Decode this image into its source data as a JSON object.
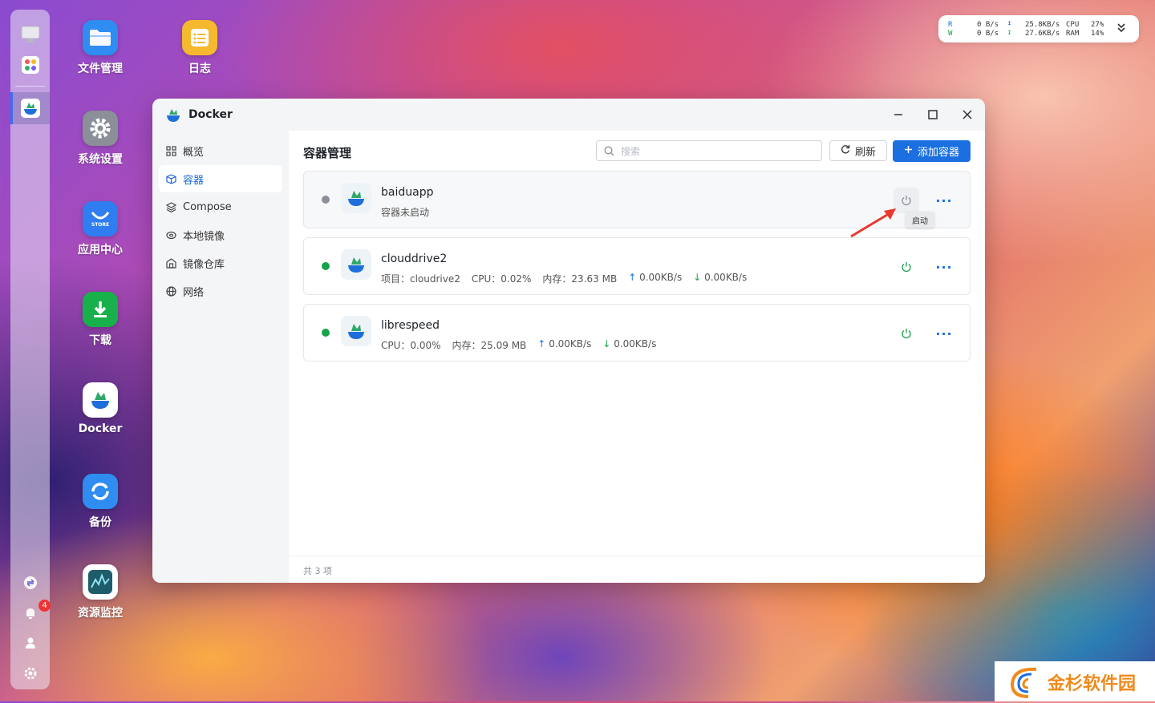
{
  "desktop": {
    "icons": [
      {
        "label": "文件管理",
        "icon": "folder-icon",
        "color": "#2f8cf0"
      },
      {
        "label": "日志",
        "icon": "log-icon",
        "color": "#f5b82e"
      },
      {
        "label": "系统设置",
        "icon": "gear-icon",
        "color": "#8a8f99"
      },
      {
        "label": "应用中心",
        "icon": "store-icon",
        "color": "#2f7df0"
      },
      {
        "label": "下载",
        "icon": "download-icon",
        "color": "#18b04a"
      },
      {
        "label": "Docker",
        "icon": "docker-icon",
        "color": "#ffffff"
      },
      {
        "label": "备份",
        "icon": "backup-icon",
        "color": "#2f8cf0"
      },
      {
        "label": "资源监控",
        "icon": "monitor-icon",
        "color": "#1f5c6a"
      }
    ],
    "store_text": "STORE"
  },
  "dock": {
    "notification_count": "4"
  },
  "status": {
    "r_label": "R",
    "w_label": "W",
    "r_value": "0  B/s",
    "w_value": "0  B/s",
    "up_value": "25.8KB/s",
    "down_value": "27.6KB/s",
    "cpu_label": "CPU",
    "ram_label": "RAM",
    "cpu_value": "27%",
    "ram_value": "14%"
  },
  "window": {
    "title": "Docker",
    "sidebar": [
      {
        "label": "概览",
        "icon": "grid-icon"
      },
      {
        "label": "容器",
        "icon": "cube-icon",
        "active": true
      },
      {
        "label": "Compose",
        "icon": "layers-icon"
      },
      {
        "label": "本地镜像",
        "icon": "disk-icon"
      },
      {
        "label": "镜像仓库",
        "icon": "warehouse-icon"
      },
      {
        "label": "网络",
        "icon": "globe-icon"
      }
    ],
    "page_title": "容器管理",
    "search_placeholder": "搜索",
    "refresh_label": "刷新",
    "add_label": "添加容器",
    "containers": [
      {
        "name": "baiduapp",
        "status": "stopped",
        "status_color": "#8a8f99",
        "info": [
          "容器未启动"
        ]
      },
      {
        "name": "clouddrive2",
        "status": "running",
        "status_color": "#18a34a",
        "info": [
          "项目：cloudrive2",
          "CPU：0.02%",
          "内存：23.63 MB"
        ],
        "up": "0.00KB/s",
        "down": "0.00KB/s"
      },
      {
        "name": "librespeed",
        "status": "running",
        "status_color": "#18a34a",
        "info": [
          "CPU：0.00%",
          "内存：25.09 MB"
        ],
        "up": "0.00KB/s",
        "down": "0.00KB/s"
      }
    ],
    "tooltip": "启动",
    "footer": "共 3 项"
  },
  "watermark": "金杉软件园",
  "accent_color": "#1b6fe0"
}
